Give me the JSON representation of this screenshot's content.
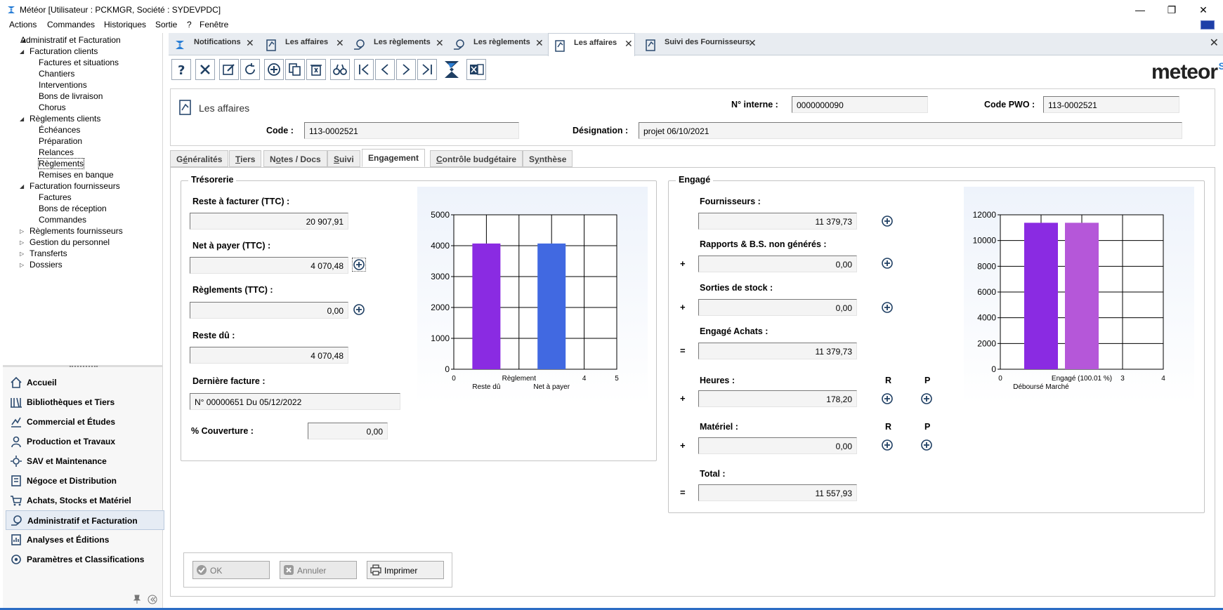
{
  "window": {
    "title": "Météor [Utilisateur : PCKMGR, Société : SYDEVPDC]",
    "minimize": "—",
    "restore": "❐",
    "close": "✕"
  },
  "menu": [
    "Actions",
    "Commandes",
    "Historiques",
    "Sortie",
    "?",
    "Fenêtre"
  ],
  "tree": [
    {
      "label": "Administratif et Facturation",
      "level": 0,
      "arrow": "◢"
    },
    {
      "label": "Facturation clients",
      "level": 1,
      "arrow": "◢"
    },
    {
      "label": "Factures et situations",
      "level": 2
    },
    {
      "label": "Chantiers",
      "level": 2
    },
    {
      "label": "Interventions",
      "level": 2
    },
    {
      "label": "Bons de livraison",
      "level": 2
    },
    {
      "label": "Chorus",
      "level": 2
    },
    {
      "label": "Règlements clients",
      "level": 1,
      "arrow": "◢"
    },
    {
      "label": "Échéances",
      "level": 2
    },
    {
      "label": "Préparation",
      "level": 2
    },
    {
      "label": "Relances",
      "level": 2
    },
    {
      "label": "Règlements",
      "level": 2,
      "selected": true
    },
    {
      "label": "Remises en banque",
      "level": 2
    },
    {
      "label": "Facturation fournisseurs",
      "level": 1,
      "arrow": "◢"
    },
    {
      "label": "Factures",
      "level": 2
    },
    {
      "label": "Bons de réception",
      "level": 2
    },
    {
      "label": "Commandes",
      "level": 2
    },
    {
      "label": "Règlements fournisseurs",
      "level": 1,
      "arrow": "▷"
    },
    {
      "label": "Gestion du personnel",
      "level": 1,
      "arrow": "▷"
    },
    {
      "label": "Transferts",
      "level": 1,
      "arrow": "▷"
    },
    {
      "label": "Dossiers",
      "level": 1,
      "arrow": "▷"
    }
  ],
  "nav": [
    {
      "label": "Accueil",
      "icon": "home-icon"
    },
    {
      "label": "Bibliothèques et Tiers",
      "icon": "library-icon"
    },
    {
      "label": "Commercial et Études",
      "icon": "commercial-icon"
    },
    {
      "label": "Production et Travaux",
      "icon": "worker-icon"
    },
    {
      "label": "SAV et Maintenance",
      "icon": "maintenance-icon"
    },
    {
      "label": "Négoce et Distribution",
      "icon": "trade-icon"
    },
    {
      "label": "Achats, Stocks et Matériel",
      "icon": "cart-icon"
    },
    {
      "label": "Administratif et Facturation",
      "icon": "billing-icon",
      "active": true
    },
    {
      "label": "Analyses et Éditions",
      "icon": "analysis-icon"
    },
    {
      "label": "Paramètres et Classifications",
      "icon": "settings-icon"
    }
  ],
  "doc_tabs": [
    {
      "label": "Notifications",
      "icon": "notifications-icon"
    },
    {
      "label": "Les affaires",
      "icon": "affaires-icon"
    },
    {
      "label": "Les règlements",
      "icon": "reglements-icon"
    },
    {
      "label": "Les règlements",
      "icon": "reglements-icon"
    },
    {
      "label": "Les affaires",
      "icon": "affaires-icon",
      "active": true
    },
    {
      "label": "Suivi des Fournisseurs",
      "icon": "suivi-icon"
    }
  ],
  "brand": {
    "logo_text": "meteor"
  },
  "header": {
    "title": "Les affaires",
    "num_interne_label": "N° interne :",
    "num_interne": "0000000090",
    "code_pwo_label": "Code PWO :",
    "code_pwo": "113-0002521",
    "code_label": "Code :",
    "code": "113-0002521",
    "designation_label": "Désignation :",
    "designation": "projet 06/10/2021"
  },
  "content_tabs": [
    {
      "pre": "G",
      "u": "é",
      "post": "néralités"
    },
    {
      "pre": "",
      "u": "T",
      "post": "iers"
    },
    {
      "pre": "N",
      "u": "o",
      "post": "tes / Docs"
    },
    {
      "pre": "",
      "u": "S",
      "post": "uivi"
    },
    {
      "pre": "Engagement",
      "u": "",
      "post": "",
      "active": true
    },
    {
      "pre": "",
      "u": "C",
      "post": "ontrôle budgétaire"
    },
    {
      "pre": "S",
      "u": "y",
      "post": "nthèse"
    }
  ],
  "tresorerie": {
    "title": "Trésorerie",
    "reste_facturer_label": "Reste à facturer (TTC) :",
    "reste_facturer": "20 907,91",
    "net_payer_label": "Net à payer (TTC) :",
    "net_payer": "4 070,48",
    "reglements_label": "Règlements (TTC) :",
    "reglements": "0,00",
    "reste_du_label": "Reste dû :",
    "reste_du": "4 070,48",
    "derniere_facture_label": "Dernière facture :",
    "derniere_facture": "N° 00000651 Du 05/12/2022",
    "couverture_label": "% Couverture :",
    "couverture": "0,00"
  },
  "engage": {
    "title": "Engagé",
    "fournisseurs_label": "Fournisseurs :",
    "fournisseurs": "11 379,73",
    "rapports_label": "Rapports & B.S. non générés :",
    "rapports": "0,00",
    "sorties_label": "Sorties de stock :",
    "sorties": "0,00",
    "engage_achats_label": "Engagé Achats :",
    "engage_achats": "11 379,73",
    "heures_label": "Heures :",
    "heures": "178,20",
    "materiel_label": "Matériel :",
    "materiel": "0,00",
    "total_label": "Total :",
    "total": "11 557,93",
    "col_r": "R",
    "col_p": "P",
    "plus": "+",
    "equals": "="
  },
  "chart_data": [
    {
      "type": "bar",
      "categories": [
        "Reste dû",
        "Règlement",
        "Net à payer"
      ],
      "values": [
        4070.48,
        0,
        4070.48
      ],
      "colors": [
        "#8a2be2",
        "#ffffff",
        "#4169e1"
      ],
      "x_ticks": [
        "0",
        "4",
        "5"
      ],
      "y_ticks": [
        "0",
        "1000",
        "2000",
        "3000",
        "4000",
        "5000"
      ],
      "ylim": [
        0,
        5000
      ],
      "grid": true
    },
    {
      "type": "bar",
      "categories": [
        "Déboursé Marché",
        "Engagé (100.01 %)"
      ],
      "values": [
        11379.73,
        11379.73
      ],
      "colors": [
        "#8a2be2",
        "#b557d9"
      ],
      "x_ticks": [
        "0",
        "3",
        "4"
      ],
      "y_ticks": [
        "0",
        "2000",
        "4000",
        "6000",
        "8000",
        "10000",
        "12000"
      ],
      "ylim": [
        0,
        12000
      ],
      "grid": true
    }
  ],
  "buttons": {
    "ok": "OK",
    "annuler": "Annuler",
    "imprimer": "Imprimer"
  }
}
